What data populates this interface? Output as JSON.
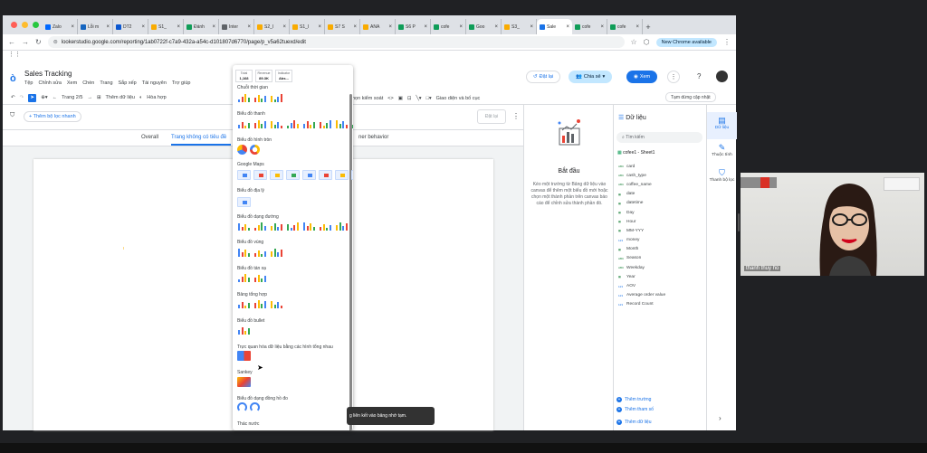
{
  "browser": {
    "tabs": [
      {
        "label": "Zalo",
        "color": "#0068ff"
      },
      {
        "label": "Lỗi m",
        "color": "#1565c0"
      },
      {
        "label": "DT2",
        "color": "#0b57d0"
      },
      {
        "label": "S1_",
        "color": "#f9ab00"
      },
      {
        "label": "Đánh",
        "color": "#0f9d58"
      },
      {
        "label": "Inter",
        "color": "#5f6368"
      },
      {
        "label": "S2_I",
        "color": "#f9ab00"
      },
      {
        "label": "S1_I",
        "color": "#f9ab00"
      },
      {
        "label": "S7 S",
        "color": "#f9ab00"
      },
      {
        "label": "ANA",
        "color": "#f9ab00"
      },
      {
        "label": "S6 P",
        "color": "#0f9d58"
      },
      {
        "label": "cofe",
        "color": "#0f9d58"
      },
      {
        "label": "Goo",
        "color": "#0f9d58"
      },
      {
        "label": "S3_",
        "color": "#f9ab00"
      },
      {
        "label": "Sale",
        "color": "#1a73e8",
        "active": true
      },
      {
        "label": "cofe",
        "color": "#0f9d58"
      },
      {
        "label": "cofe",
        "color": "#0f9d58"
      }
    ],
    "url": "lookerstudio.google.com/reporting/1ab0722f-c7a9-432a-a54c-d101807d6770/page/p_v5a62tuexd/edit",
    "new_chrome": "New Chrome available"
  },
  "app": {
    "title": "Sales Tracking",
    "menus": [
      "Tệp",
      "Chỉnh sửa",
      "Xem",
      "Chèn",
      "Trang",
      "Sắp xếp",
      "Tài nguyên",
      "Trợ giúp"
    ],
    "reset_label": "Đặt lại",
    "share_label": "Chia sẻ",
    "view_label": "Xem"
  },
  "toolbar": {
    "page_label": "Trang 2/5",
    "add_data_label": "Thêm dữ liệu",
    "blend_label": "Hòa hợp",
    "controls_label": "họn kiểm soát",
    "theme_label": "Giao diện và bố cục",
    "pause_label": "Tạm dừng cập nhật"
  },
  "filterbar": {
    "add_filter_label": "+ Thêm bộ lọc nhanh",
    "undo_label": "Đặt lại"
  },
  "page_tabs": {
    "overall": "Overall",
    "active": "Trang không có tiêu đề",
    "behavior": "ner behavior"
  },
  "chart_menu": {
    "scorecards": [
      {
        "label": "Total",
        "value": "1,168"
      },
      {
        "label": "Revenue",
        "value": "89.3K"
      },
      {
        "label": "Indicator",
        "value": "Abs..."
      }
    ],
    "sections": [
      "Chuỗi thời gian",
      "Biểu đồ thanh",
      "Biểu đồ hình tròn",
      "Google Maps",
      "Biểu đồ địa lý",
      "Biểu đồ dạng đường",
      "Biểu đồ vùng",
      "Biểu đồ tán xạ",
      "Bảng tổng hợp",
      "Biểu đồ bullet",
      "Trực quan hóa dữ liệu bằng các hình tổng nhau",
      "Sankey",
      "Biểu đồ dạng đồng hồ đo",
      "Thác nước"
    ]
  },
  "snackbar": {
    "text": "g liên kết vào bảng nhớ tạm."
  },
  "properties": {
    "heading": "Bắt đầu",
    "body": "Kéo một trường từ Bảng dữ liệu vào canvas để thêm một biểu đồ mới hoặc chọn một thành phần trên canvas báo cáo để chỉnh sửa thành phần đó."
  },
  "data_panel": {
    "title": "Dữ liệu",
    "search_placeholder": "Tìm kiếm",
    "source": "cofee1 - Sheet1",
    "fields": [
      {
        "name": "card",
        "type": "dim"
      },
      {
        "name": "cash_type",
        "type": "dim"
      },
      {
        "name": "coffee_name",
        "type": "dim"
      },
      {
        "name": "date",
        "type": "date"
      },
      {
        "name": "datetime",
        "type": "date"
      },
      {
        "name": "Day",
        "type": "date"
      },
      {
        "name": "Hour",
        "type": "date"
      },
      {
        "name": "MM-YYY",
        "type": "date"
      },
      {
        "name": "money",
        "type": "metric"
      },
      {
        "name": "Month",
        "type": "date"
      },
      {
        "name": "Season",
        "type": "dim"
      },
      {
        "name": "Weekday",
        "type": "dim"
      },
      {
        "name": "Year",
        "type": "date"
      },
      {
        "name": "AOV",
        "type": "metric"
      },
      {
        "name": "Average order value",
        "type": "metric"
      },
      {
        "name": "Record Count",
        "type": "metric"
      }
    ],
    "add_field": "Thêm trường",
    "add_param": "Thêm tham số",
    "add_data": "Thêm dữ liệu"
  },
  "rail": {
    "data": "Dữ liệu",
    "properties": "Thuộc tính",
    "filter": "Thanh bộ lọc"
  },
  "video": {
    "participant": "thanh thuy ho"
  }
}
